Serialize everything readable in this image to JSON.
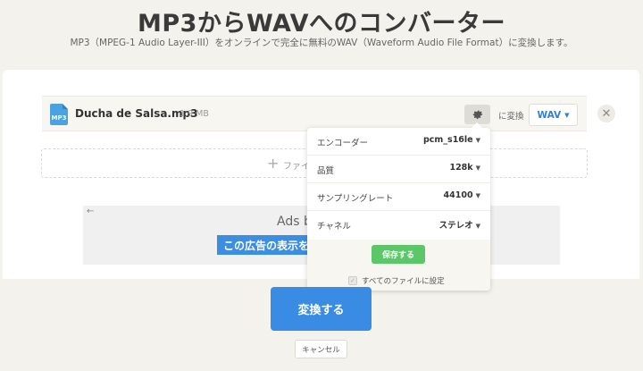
{
  "header": {
    "title": "MP3からWAVへのコンバーター",
    "subtitle": "MP3（MPEG-1 Audio Layer-III）をオンラインで完全に無料のWAV（Waveform Audio File Format）に変換します。"
  },
  "file": {
    "icon_label": "MP3",
    "name": "Ducha de Salsa.mp3",
    "size": "1.9 MB",
    "convert_to_label": "に変換",
    "format": "WAV"
  },
  "dropzone": {
    "label": "ファイ"
  },
  "ads": {
    "text": "Ads b",
    "button_label": "この広告の表示を"
  },
  "settings": {
    "rows": [
      {
        "label": "エンコーダー",
        "value": "pcm_s16le"
      },
      {
        "label": "品質",
        "value": "128k"
      },
      {
        "label": "サンプリングレート",
        "value": "44100"
      },
      {
        "label": "チャネル",
        "value": "ステレオ"
      }
    ],
    "save_label": "保存する",
    "apply_all_label": "すべてのファイルに設定"
  },
  "actions": {
    "convert_label": "変換する",
    "cancel_label": "キャンセル"
  },
  "icons": {
    "file": "file-audio-icon",
    "gear": "gear-icon",
    "close": "close-icon",
    "plus": "plus-icon",
    "caret": "caret-down-icon",
    "check": "check-icon",
    "back": "arrow-left-icon"
  },
  "colors": {
    "accent": "#3a8be4",
    "save": "#5cc768",
    "file_icon": "#4aa3df"
  }
}
